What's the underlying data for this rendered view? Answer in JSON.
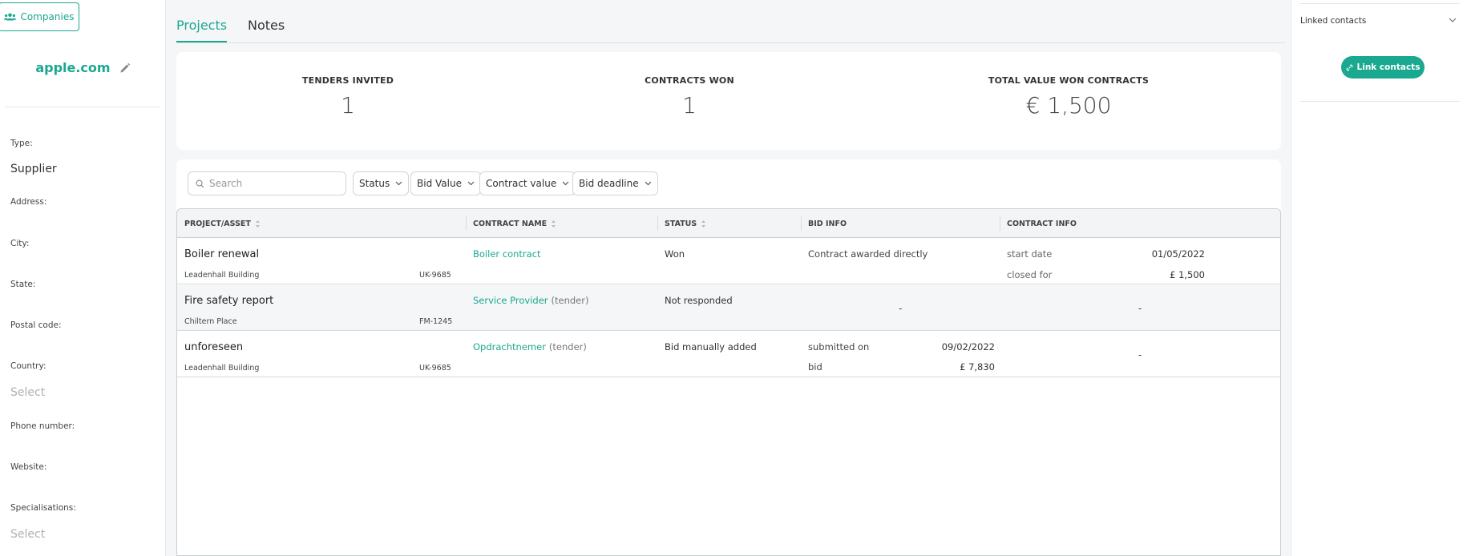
{
  "sidebar": {
    "companies_label": "Companies",
    "company_name": "apple.com",
    "fields": [
      {
        "label": "Type:",
        "value": "Supplier",
        "placeholder": false
      },
      {
        "label": "Address:",
        "value": "",
        "placeholder": false
      },
      {
        "label": "City:",
        "value": "",
        "placeholder": false
      },
      {
        "label": "State:",
        "value": "",
        "placeholder": false
      },
      {
        "label": "Postal code:",
        "value": "",
        "placeholder": false
      },
      {
        "label": "Country:",
        "value": "Select",
        "placeholder": true
      },
      {
        "label": "Phone number:",
        "value": "",
        "placeholder": false
      },
      {
        "label": "Website:",
        "value": "",
        "placeholder": false
      },
      {
        "label": "Specialisations:",
        "value": "Select",
        "placeholder": true
      }
    ]
  },
  "tabs": [
    {
      "label": "Projects",
      "active": true
    },
    {
      "label": "Notes",
      "active": false
    }
  ],
  "stats": [
    {
      "label": "TENDERS INVITED",
      "value": "1"
    },
    {
      "label": "CONTRACTS WON",
      "value": "1"
    },
    {
      "label": "TOTAL VALUE WON CONTRACTS",
      "value": "€ 1,500"
    }
  ],
  "search": {
    "placeholder": "Search"
  },
  "filters": [
    "Status",
    "Bid Value",
    "Contract value",
    "Bid deadline"
  ],
  "table": {
    "headers": [
      "PROJECT/ASSET",
      "CONTRACT NAME",
      "STATUS",
      "BID INFO",
      "CONTRACT INFO"
    ],
    "rows": [
      {
        "project": "Boiler renewal",
        "asset": "Leadenhall Building",
        "code": "UK-9685",
        "contract": "Boiler contract",
        "tag": "",
        "status": "Won",
        "bid_text": "Contract awarded directly",
        "contract_info": [
          {
            "label": "start date",
            "value": "01/05/2022"
          },
          {
            "label": "closed for",
            "value": "£ 1,500"
          }
        ]
      },
      {
        "project": "Fire safety report",
        "asset": "Chiltern Place",
        "code": "FM-1245",
        "contract": "Service Provider",
        "tag": "(tender)",
        "status": "Not responded",
        "bid_dash": "-",
        "contract_dash": "-"
      },
      {
        "project": "unforeseen",
        "asset": "Leadenhall Building",
        "code": "UK-9685",
        "contract": "Opdrachtnemer",
        "tag": "(tender)",
        "status": "Bid manually added",
        "bid_info": [
          {
            "label": "submitted on",
            "value": "09/02/2022"
          },
          {
            "label": "bid",
            "value": "£ 7,830"
          }
        ],
        "contract_dash": "-"
      }
    ]
  },
  "right_panel": {
    "title": "Linked contacts",
    "link_button": "Link contacts"
  },
  "colors": {
    "accent": "#1aa890",
    "background": "#f4f6f7"
  }
}
